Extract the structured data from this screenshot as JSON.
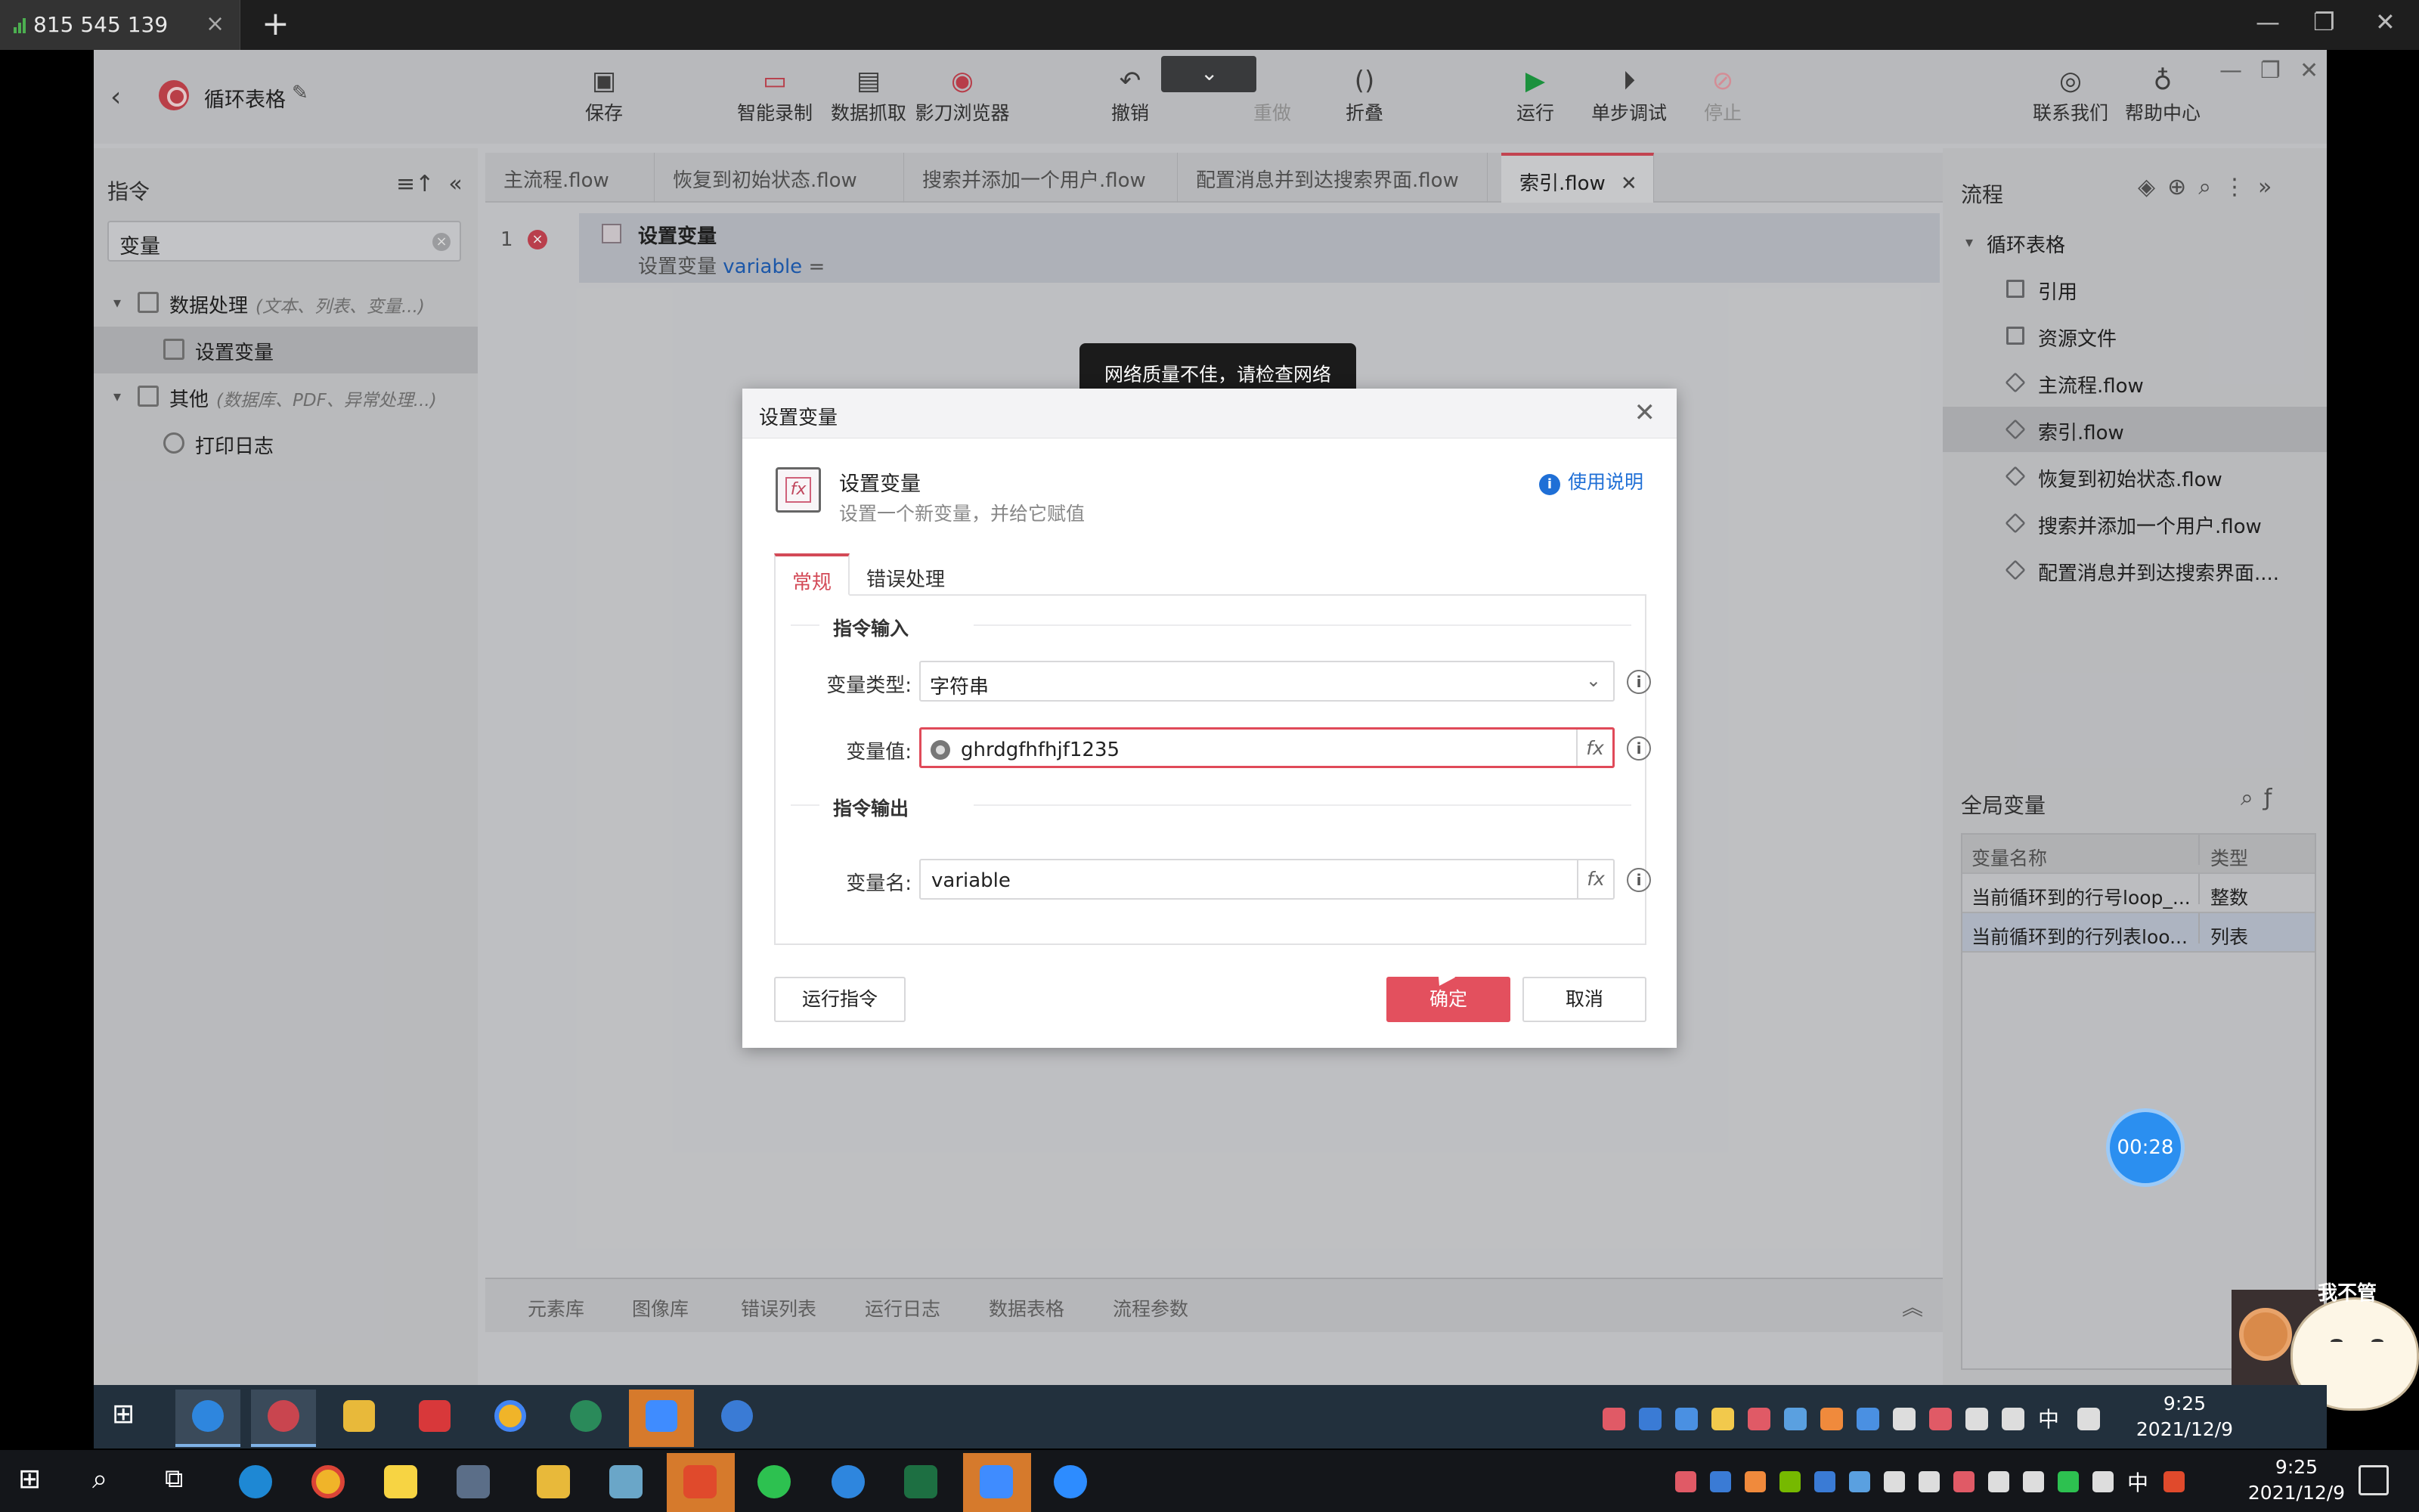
{
  "outer": {
    "tab_title": "815 545 139",
    "tab_close": "×",
    "new_tab": "+",
    "minimize": "—",
    "restore": "❐",
    "close": "✕"
  },
  "app": {
    "project_name": "循环表格",
    "toolbar": {
      "save": "保存",
      "smart_record": "智能录制",
      "data_scrape": "数据抓取",
      "shadow_browser": "影刀浏览器",
      "undo": "撤销",
      "redo": "重做",
      "fold": "折叠",
      "run": "运行",
      "step_debug": "单步调试",
      "stop": "停止",
      "contact": "联系我们",
      "help": "帮助中心"
    },
    "left_panel": {
      "title": "指令",
      "search_value": "变量",
      "groups": [
        {
          "label": "数据处理",
          "hint": "(文本、列表、变量...)",
          "items": [
            "设置变量"
          ]
        },
        {
          "label": "其他",
          "hint": "(数据库、PDF、异常处理...)",
          "items": [
            "打印日志"
          ]
        }
      ]
    },
    "tabs": [
      "主流程.flow",
      "恢复到初始状态.flow",
      "搜索并添加一个用户.flow",
      "配置消息并到达搜索界面.flow",
      "索引.flow"
    ],
    "active_tab_index": 4,
    "steps": [
      {
        "num": "1",
        "title": "设置变量",
        "desc_prefix": "设置变量",
        "var": "variable",
        "desc_suffix": "="
      }
    ],
    "bottom_tabs": [
      "元素库",
      "图像库",
      "错误列表",
      "运行日志",
      "数据表格",
      "流程参数"
    ],
    "right_panel": {
      "title": "流程",
      "root": "循环表格",
      "items": [
        "引用",
        "资源文件",
        "主流程.flow",
        "索引.flow",
        "恢复到初始状态.flow",
        "搜索并添加一个用户.flow",
        "配置消息并到达搜索界面...."
      ],
      "selected_index": 3,
      "globals_title": "全局变量",
      "globals_headers": [
        "变量名称",
        "类型"
      ],
      "globals_rows": [
        {
          "name": "当前循环到的行号loop_...",
          "type": "整数"
        },
        {
          "name": "当前循环到的行列表loo...",
          "type": "列表"
        }
      ]
    }
  },
  "toast": "网络质量不佳，请检查网络",
  "dialog": {
    "title": "设置变量",
    "cmd_name": "设置变量",
    "cmd_desc": "设置一个新变量，并给它赋值",
    "help_link": "使用说明",
    "tabs": [
      "常规",
      "错误处理"
    ],
    "input_section": "指令输入",
    "output_section": "指令输出",
    "var_type_label": "变量类型:",
    "var_type_value": "字符串",
    "var_value_label": "变量值:",
    "var_value": "ghrdgfhfhjf1235",
    "var_name_label": "变量名:",
    "var_name": "variable",
    "btn_run": "运行指令",
    "btn_ok": "确定",
    "btn_cancel": "取消"
  },
  "timer": "00:28",
  "mascot_text": "我不管",
  "inner_clock": {
    "time": "9:25",
    "date": "2021/12/9"
  },
  "host_clock": {
    "time": "9:25",
    "date": "2021/12/9"
  },
  "ime": "中",
  "colors": {
    "accent": "#e3505e",
    "link": "#1f6fd6",
    "toast_bg": "#1b1b1b"
  }
}
